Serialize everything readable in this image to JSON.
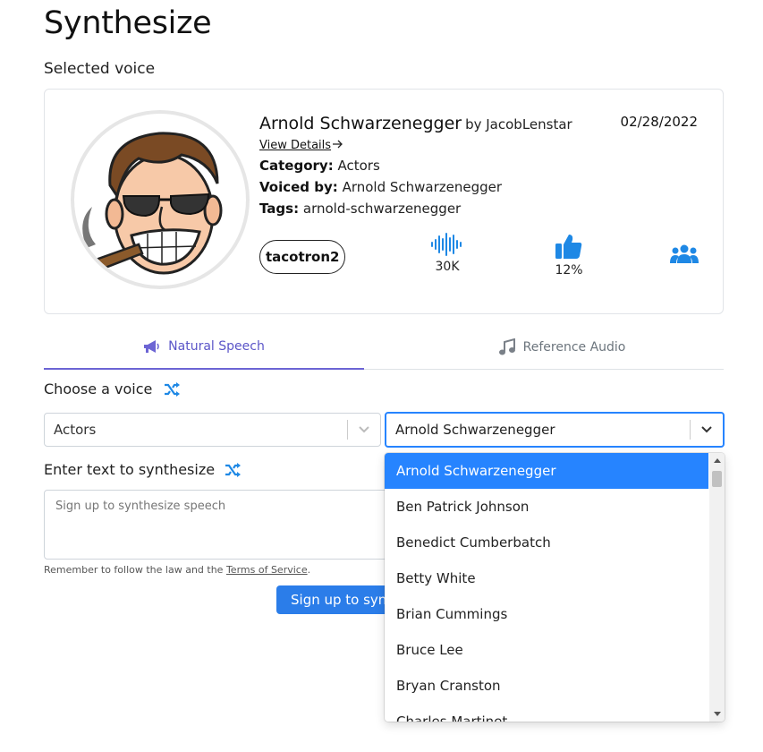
{
  "page": {
    "title": "Synthesize",
    "selected_voice_label": "Selected voice"
  },
  "voice": {
    "name": "Arnold Schwarzenegger",
    "by": "by JacobLenstar",
    "date": "02/28/2022",
    "view_details": "View Details",
    "category_label": "Category:",
    "category": "Actors",
    "voiced_by_label": "Voiced by:",
    "voiced_by": "Arnold Schwarzenegger",
    "tags_label": "Tags:",
    "tags": "arnold-schwarzenegger",
    "model": "tacotron2",
    "uses": "30K",
    "rating": "12%",
    "avatar_icon": "cartoon-man-with-cigar-avatar"
  },
  "tabs": [
    {
      "label": "Natural Speech",
      "icon": "megaphone-icon",
      "active": true
    },
    {
      "label": "Reference Audio",
      "icon": "music-note-icon",
      "active": false
    }
  ],
  "form": {
    "choose_voice_label": "Choose a voice",
    "category_value": "Actors",
    "voice_value": "Arnold Schwarzenegger",
    "enter_text_label": "Enter text to synthesize",
    "text_placeholder": "Sign up to synthesize speech",
    "law_note_prefix": "Remember to follow the law and the ",
    "law_note_link": "Terms of Service",
    "law_note_suffix": ".",
    "signup_button": "Sign up to synthesize"
  },
  "dropdown": {
    "options": [
      "Arnold Schwarzenegger",
      "Ben Patrick Johnson",
      "Benedict Cumberbatch",
      "Betty White",
      "Brian Cummings",
      "Bruce Lee",
      "Bryan Cranston",
      "Charles Martinet"
    ],
    "selected_index": 0
  },
  "colors": {
    "accent": "#2684ff",
    "tab_active": "#5b55c8",
    "stat_icon": "#1e88e5",
    "button": "#2b7de9"
  }
}
